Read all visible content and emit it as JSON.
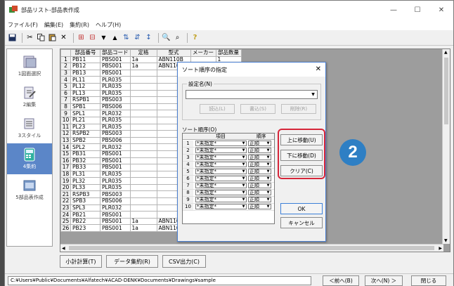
{
  "window": {
    "title": "部品リスト-部品表作成",
    "controls": {
      "minimize": "—",
      "maximize": "☐",
      "close": "✕"
    }
  },
  "menu": [
    "ファイル(F)",
    "編集(E)",
    "集約(R)",
    "ヘルプ(H)"
  ],
  "toolbar_icons": [
    "save-icon",
    "cut-icon",
    "copy-icon",
    "paste-icon",
    "delete-icon",
    "insert-row-icon",
    "delete-row-icon",
    "move-down-icon",
    "move-up-icon",
    "sort-ascending-icon",
    "sort-descending-icon",
    "sort-custom-icon",
    "search-icon",
    "find-icon",
    "help-icon"
  ],
  "sidebar": {
    "items": [
      {
        "label": "1図面選択",
        "icon": "drawing-select-icon"
      },
      {
        "label": "2編集",
        "icon": "edit-icon"
      },
      {
        "label": "3スタイル",
        "icon": "style-icon"
      },
      {
        "label": "4集約",
        "icon": "aggregate-icon",
        "active": true
      },
      {
        "label": "5部品表作成",
        "icon": "parts-list-icon"
      }
    ]
  },
  "grid": {
    "columns": [
      "部品番号",
      "部品コード",
      "定格",
      "型式",
      "メーカー",
      "部品数量"
    ],
    "rows": [
      [
        "PB11",
        "PBS001",
        "1a",
        "ABN110B",
        "",
        "1"
      ],
      [
        "PB12",
        "PBS001",
        "1a",
        "ABN110B",
        "",
        "1"
      ],
      [
        "PB13",
        "PBS001",
        "",
        "",
        "",
        ""
      ],
      [
        "PL11",
        "PLR035",
        "",
        "",
        "",
        ""
      ],
      [
        "PL12",
        "PLR035",
        "",
        "",
        "",
        ""
      ],
      [
        "PL13",
        "PLR035",
        "",
        "",
        "",
        ""
      ],
      [
        "RSPB1",
        "PBS003",
        "",
        "",
        "",
        ""
      ],
      [
        "SPB1",
        "PBS006",
        "",
        "",
        "",
        ""
      ],
      [
        "SPL1",
        "PLR032",
        "",
        "",
        "",
        ""
      ],
      [
        "PL21",
        "PLR035",
        "",
        "",
        "",
        ""
      ],
      [
        "PL23",
        "PLR035",
        "",
        "",
        "",
        ""
      ],
      [
        "RSPB2",
        "PBS003",
        "",
        "",
        "",
        ""
      ],
      [
        "SPB2",
        "PBS006",
        "",
        "",
        "",
        ""
      ],
      [
        "SPL2",
        "PLR032",
        "",
        "",
        "",
        ""
      ],
      [
        "PB31",
        "PBS001",
        "",
        "",
        "",
        ""
      ],
      [
        "PB32",
        "PBS001",
        "",
        "",
        "",
        ""
      ],
      [
        "PB33",
        "PBS001",
        "",
        "",
        "",
        ""
      ],
      [
        "PL31",
        "PLR035",
        "",
        "",
        "",
        ""
      ],
      [
        "PL32",
        "PLR035",
        "",
        "",
        "",
        ""
      ],
      [
        "PL33",
        "PLR035",
        "",
        "",
        "",
        ""
      ],
      [
        "RSPB3",
        "PBS003",
        "",
        "",
        "",
        ""
      ],
      [
        "SPB3",
        "PBS006",
        "",
        "",
        "",
        ""
      ],
      [
        "SPL3",
        "PLR032",
        "",
        "",
        "",
        ""
      ],
      [
        "PB21",
        "PBS001",
        "",
        "",
        "",
        ""
      ],
      [
        "PB22",
        "PBS001",
        "1a",
        "ABN110B",
        "",
        "1"
      ],
      [
        "PB23",
        "PBS001",
        "1a",
        "ABN110B",
        "",
        "1"
      ]
    ]
  },
  "bottom_buttons": {
    "subtotal": "小計計算(T)",
    "aggregate": "データ集約(R)",
    "csv": "CSV出力(C)"
  },
  "status": {
    "path": "C:¥Users¥Public¥Documents¥Alfatech¥ACAD-DENK¥Documents¥Drawings¥sample",
    "prev": "＜前へ(B)",
    "next": "次へ(N) ＞",
    "close": "閉じる"
  },
  "dialog": {
    "title": "ソート順序の指定",
    "close": "✕",
    "settings_label": "設定名(N)",
    "combo_value": "",
    "load": "読込(L)",
    "write": "書込(S)",
    "delete": "削除(R)",
    "sort_order_label": "ソート順序(O)",
    "col_item": "項目",
    "col_order": "順序",
    "rows": [
      {
        "n": "1",
        "item": "*未指定*",
        "order": "正順"
      },
      {
        "n": "2",
        "item": "*未指定*",
        "order": "正順"
      },
      {
        "n": "3",
        "item": "*未指定*",
        "order": "正順"
      },
      {
        "n": "4",
        "item": "*未指定*",
        "order": "正順"
      },
      {
        "n": "5",
        "item": "*未指定*",
        "order": "正順"
      },
      {
        "n": "6",
        "item": "*未指定*",
        "order": "正順"
      },
      {
        "n": "7",
        "item": "*未指定*",
        "order": "正順"
      },
      {
        "n": "8",
        "item": "*未指定*",
        "order": "正順"
      },
      {
        "n": "9",
        "item": "*未指定*",
        "order": "正順"
      },
      {
        "n": "10",
        "item": "*未指定*",
        "order": "正順"
      }
    ],
    "move_up": "上に移動(U)",
    "move_down": "下に移動(D)",
    "clear": "クリア(C)",
    "ok": "OK",
    "cancel": "キャンセル"
  },
  "badge": "2",
  "colors": {
    "accent": "#2e7fc4",
    "highlight": "#d6263a",
    "sidebar_active": "#5b86c8"
  }
}
